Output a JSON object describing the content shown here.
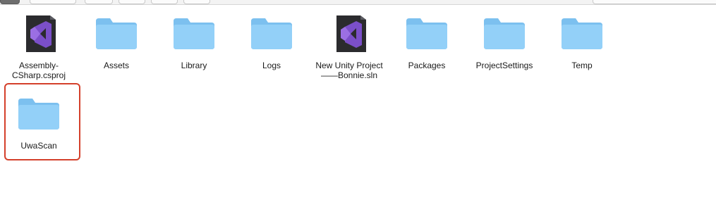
{
  "files": [
    {
      "label": "Assembly-\nCSharp.csproj",
      "kind": "vs-icon"
    },
    {
      "label": "Assets",
      "kind": "folder-icon"
    },
    {
      "label": "Library",
      "kind": "folder-icon"
    },
    {
      "label": "Logs",
      "kind": "folder-icon"
    },
    {
      "label": "New Unity Project\n——Bonnie.sln",
      "kind": "vs-icon"
    },
    {
      "label": "Packages",
      "kind": "folder-icon"
    },
    {
      "label": "ProjectSettings",
      "kind": "folder-icon"
    },
    {
      "label": "Temp",
      "kind": "folder-icon"
    },
    {
      "label": "UwaScan",
      "kind": "folder-icon",
      "highlighted": true
    }
  ],
  "colors": {
    "folder_body": "#8fcdf7",
    "folder_tab": "#7cc0ef",
    "vs_purple": "#7b4fc9",
    "selection_red": "#d4402b"
  }
}
